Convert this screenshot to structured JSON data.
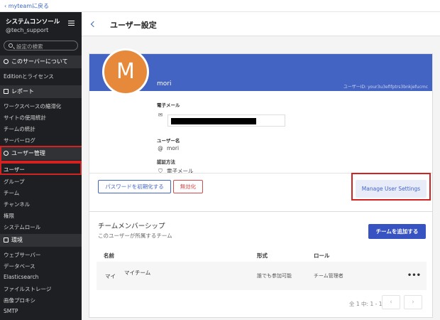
{
  "topbar": {
    "back_label": "‹ myteamに戻る"
  },
  "sidebar": {
    "title": "システムコンソール",
    "subtitle": "@tech_support",
    "search_placeholder": "設定の検索",
    "about_section": "このサーバーについて",
    "about_items": [
      "Editionとライセンス"
    ],
    "reports_section": "レポート",
    "reports_items": [
      "ワークスペースの縮滞化",
      "サイトの使用統計",
      "チームの統計",
      "サーバーログ"
    ],
    "users_section": "ユーザー管理",
    "users_items": [
      "ユーザー",
      "グループ",
      "チーム",
      "チャンネル",
      "権限",
      "システムロール"
    ],
    "env_section": "環境",
    "env_items": [
      "ウェブサーバー",
      "データベース",
      "Elasticsearch",
      "ファイルストレージ",
      "画像プロキシ",
      "SMTP"
    ]
  },
  "header": {
    "title": "ユーザー設定"
  },
  "profile": {
    "avatar_letter": "M",
    "username_display": "mori",
    "user_id": "ユーザーID: your3u3efifptrs3bnkjefucmc",
    "email_label": "電子メール",
    "username_label": "ユーザー名",
    "username_value": "mori",
    "auth_label": "認証方法",
    "auth_value": "電子メール"
  },
  "actions": {
    "reset_password": "パスワードを初期化する",
    "disable": "無効化",
    "manage_settings": "Manage User Settings"
  },
  "membership": {
    "title": "チームメンバーシップ",
    "subtitle": "このユーザーが所属するチーム",
    "add_button": "チームを追加する",
    "columns": {
      "name": "名前",
      "type": "形式",
      "role": "ロール"
    },
    "row": {
      "initials": "マイ",
      "name": "マイチーム",
      "type": "誰でも参加可能",
      "role": "チーム管理者",
      "menu": "•••"
    },
    "pagination": "全 1 中: 1 - 1",
    "prev": "‹",
    "next": "›"
  },
  "colors": {
    "accent": "#3753c2",
    "banner": "#4464c4",
    "avatar": "#e6893a",
    "highlight": "#d32222",
    "sidebar": "#1e1f22"
  }
}
